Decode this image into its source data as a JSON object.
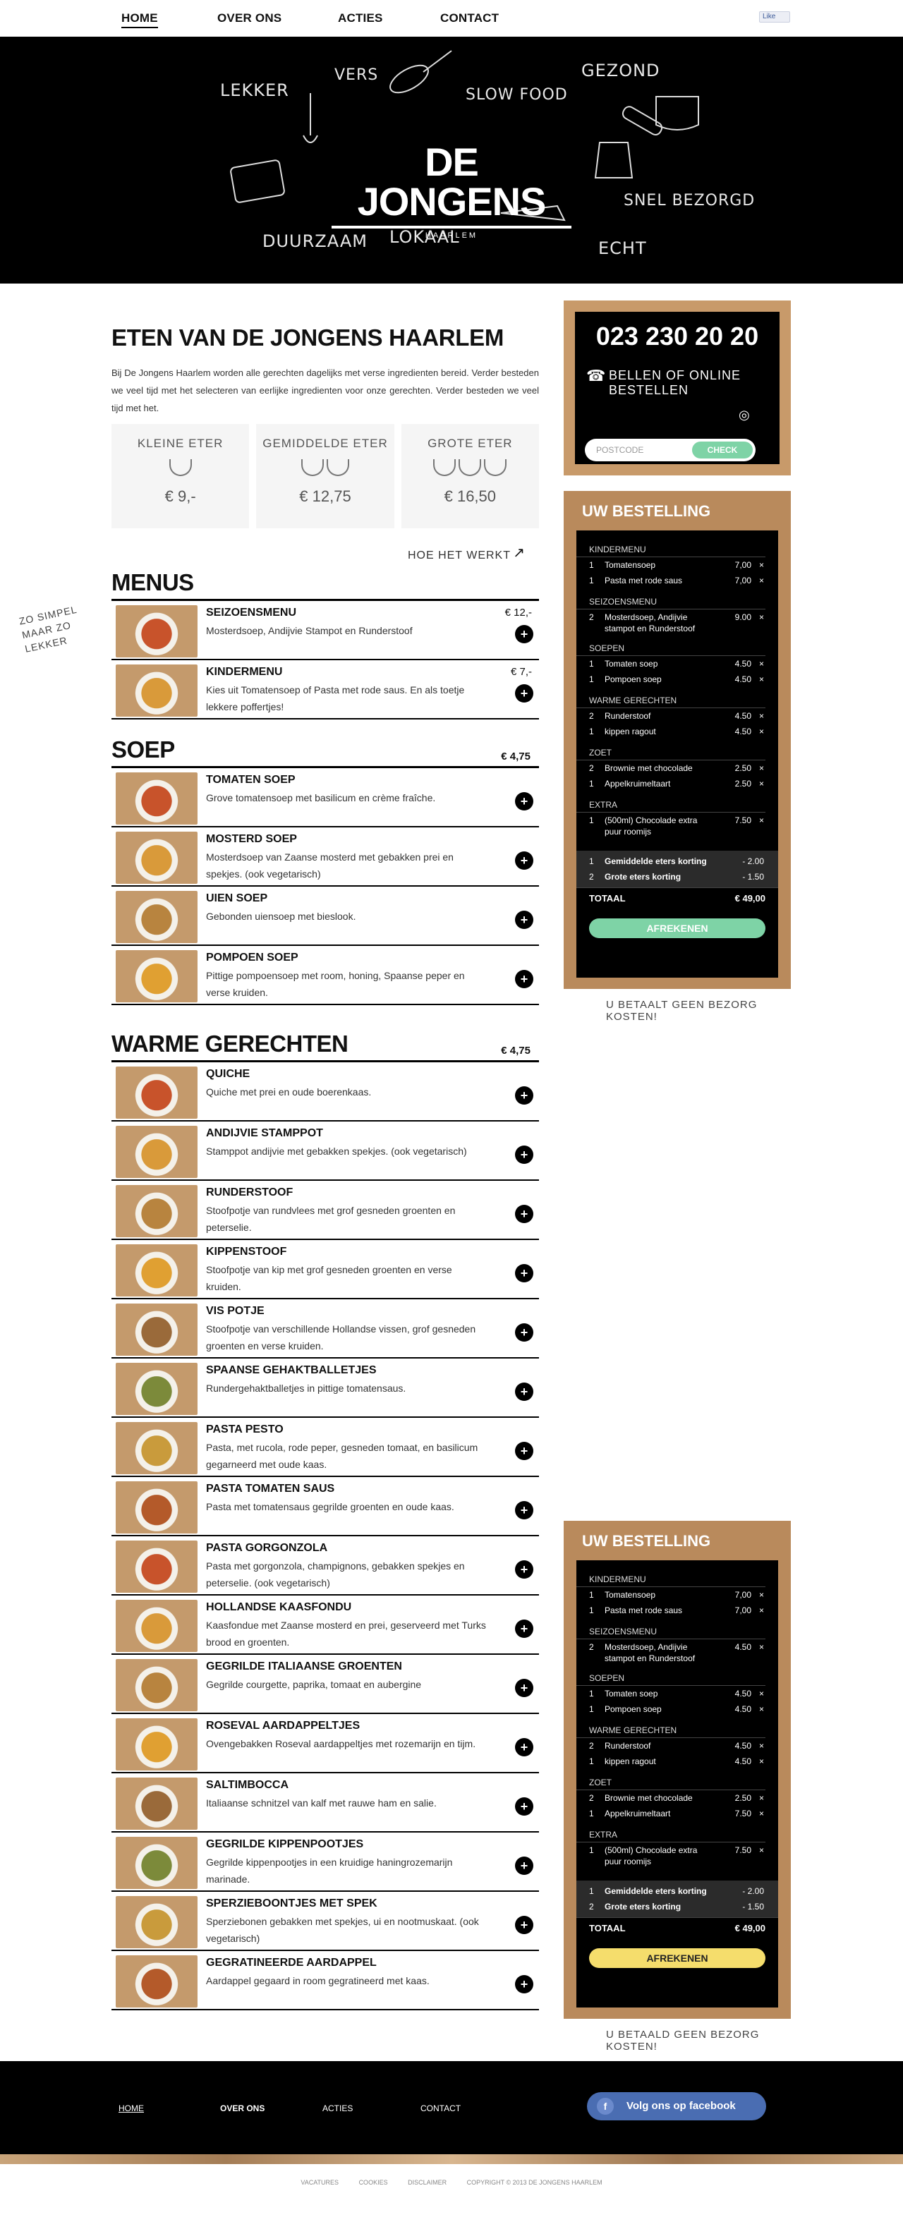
{
  "nav": {
    "home": "HOME",
    "over": "OVER ONS",
    "acties": "ACTIES",
    "contact": "CONTACT",
    "like": "Like"
  },
  "hero": {
    "words": [
      "LEKKER",
      "VERS",
      "SLOW FOOD",
      "GEZOND",
      "SNEL BEZORGD",
      "ECHT",
      "LOKAAL",
      "DUURZAAM"
    ],
    "logo_name": "DE JONGENS",
    "logo_city": "HAARLEM"
  },
  "intro": {
    "title": "ETEN VAN DE JONGENS HAARLEM",
    "text": "Bij De Jongens Haarlem worden alle gerechten dagelijks met verse ingredienten bereid. Verder besteden we veel tijd met het selecteren van eerlijke ingredienten voor onze gerechten. Verder besteden we veel tijd met het."
  },
  "sizes": [
    {
      "label": "KLEINE ETER",
      "price": "€ 9,-",
      "cups": 1
    },
    {
      "label": "GEMIDDELDE ETER",
      "price": "€ 12,75",
      "cups": 2
    },
    {
      "label": "GROTE ETER",
      "price": "€ 16,50",
      "cups": 3
    }
  ],
  "hoe": "HOE HET WERKT",
  "simpel": "ZO SIMPEL MAAR ZO LEKKER",
  "menus": {
    "title": "MENUS",
    "items": [
      {
        "name": "SEIZOENSMENU",
        "desc": "Mosterdsoep, Andijvie Stampot en Runderstoof",
        "price": "€ 12,-"
      },
      {
        "name": "KINDERMENU",
        "desc": "Kies uit Tomatensoep of Pasta met rode saus. En als toetje lekkere poffertjes!",
        "price": "€ 7,-"
      }
    ]
  },
  "soep": {
    "title": "SOEP",
    "price": "€ 4,75",
    "items": [
      {
        "name": "TOMATEN SOEP",
        "desc": "Grove tomatensoep met basilicum en crème fraîche."
      },
      {
        "name": "MOSTERD SOEP",
        "desc": "Mosterdsoep van Zaanse mosterd met gebakken prei en spekjes. (ook vegetarisch)"
      },
      {
        "name": "UIEN SOEP",
        "desc": "Gebonden uiensoep met bieslook."
      },
      {
        "name": "POMPOEN SOEP",
        "desc": "Pittige pompoensoep met room, honing, Spaanse peper en verse kruiden."
      }
    ]
  },
  "warm": {
    "title": "WARME GERECHTEN",
    "price": "€ 4,75",
    "items": [
      {
        "name": "QUICHE",
        "desc": "Quiche met prei en oude boerenkaas."
      },
      {
        "name": "ANDIJVIE STAMPPOT",
        "desc": "Stamppot andijvie met gebakken spekjes. (ook vegetarisch)"
      },
      {
        "name": "RUNDERSTOOF",
        "desc": "Stoofpotje van rundvlees met grof gesneden groenten en peterselie."
      },
      {
        "name": "KIPPENSTOOF",
        "desc": "Stoofpotje van kip met grof gesneden groenten en verse kruiden."
      },
      {
        "name": "VIS POTJE",
        "desc": "Stoofpotje van verschillende Hollandse vissen, grof gesneden groenten en verse kruiden."
      },
      {
        "name": "SPAANSE GEHAKTBALLETJES",
        "desc": "Rundergehaktballetjes in pittige tomatensaus."
      },
      {
        "name": "PASTA PESTO",
        "desc": "Pasta, met rucola, rode peper, gesneden tomaat, en basilicum gegarneerd met oude kaas."
      },
      {
        "name": "PASTA TOMATEN SAUS",
        "desc": "Pasta met tomatensaus gegrilde groenten en oude kaas."
      },
      {
        "name": "PASTA GORGONZOLA",
        "desc": "Pasta met gorgonzola, champignons, gebakken spekjes en peterselie. (ook vegetarisch)"
      },
      {
        "name": "HOLLANDSE KAASFONDU",
        "desc": "Kaasfondue met Zaanse mosterd en prei, geserveerd met Turks brood en groenten."
      },
      {
        "name": "GEGRILDE ITALIAANSE GROENTEN",
        "desc": "Gegrilde courgette, paprika, tomaat en aubergine"
      },
      {
        "name": "ROSEVAL AARDAPPELTJES",
        "desc": "Ovengebakken Roseval aardappeltjes met rozemarijn en tijm."
      },
      {
        "name": "SALTIMBOCCA",
        "desc": "Italiaanse schnitzel van kalf met rauwe ham en salie."
      },
      {
        "name": "GEGRILDE KIPPENPOOTJES",
        "desc": "Gegrilde kippenpootjes in een kruidige haningrozemarijn marinade."
      },
      {
        "name": "SPERZIEBOONTJES MET SPEK",
        "desc": "Sperziebonen gebakken met spekjes, ui en nootmuskaat. (ook vegetarisch)"
      },
      {
        "name": "GEGRATINEERDE AARDAPPEL",
        "desc": "Aardappel gegaard in room gegratineerd met kaas."
      }
    ]
  },
  "phonebox": {
    "phone": "023 230 20 20",
    "label": "BELLEN OF ONLINE BESTELLEN",
    "placeholder": "POSTCODE",
    "check": "CHECK"
  },
  "order1": {
    "title": "UW BESTELLING",
    "groups": [
      {
        "cat": "KINDERMENU",
        "lines": [
          {
            "q": "1",
            "n": "Tomatensoep",
            "p": "7,00"
          },
          {
            "q": "1",
            "n": "Pasta met rode saus",
            "p": "7,00"
          }
        ]
      },
      {
        "cat": "SEIZOENSMENU",
        "lines": [
          {
            "q": "2",
            "n": "Mosterdsoep, Andijvie stampot en Runderstoof",
            "p": "9.00"
          }
        ]
      },
      {
        "cat": "SOEPEN",
        "lines": [
          {
            "q": "1",
            "n": "Tomaten soep",
            "p": "4.50"
          },
          {
            "q": "1",
            "n": "Pompoen soep",
            "p": "4.50"
          }
        ]
      },
      {
        "cat": "WARME GERECHTEN",
        "lines": [
          {
            "q": "2",
            "n": "Runderstoof",
            "p": "4.50"
          },
          {
            "q": "1",
            "n": "kippen ragout",
            "p": "4.50"
          }
        ]
      },
      {
        "cat": "ZOET",
        "lines": [
          {
            "q": "2",
            "n": "Brownie met chocolade",
            "p": "2.50"
          },
          {
            "q": "1",
            "n": "Appelkruimeltaart",
            "p": "2.50"
          }
        ]
      },
      {
        "cat": "EXTRA",
        "lines": [
          {
            "q": "1",
            "n": "(500ml) Chocolade extra puur roomijs",
            "p": "7.50"
          }
        ]
      }
    ],
    "disc": [
      {
        "q": "1",
        "n": "Gemiddelde eters korting",
        "p": "- 2.00"
      },
      {
        "q": "2",
        "n": "Grote eters korting",
        "p": "- 1.50"
      }
    ],
    "total_label": "TOTAAL",
    "total": "€ 49,00",
    "button": "AFREKENEN",
    "btn_color": "#7ed3a6"
  },
  "order2": {
    "title": "UW BESTELLING",
    "groups": [
      {
        "cat": "KINDERMENU",
        "lines": [
          {
            "q": "1",
            "n": "Tomatensoep",
            "p": "7,00"
          },
          {
            "q": "1",
            "n": "Pasta met rode saus",
            "p": "7,00"
          }
        ]
      },
      {
        "cat": "SEIZOENSMENU",
        "lines": [
          {
            "q": "2",
            "n": "Mosterdsoep, Andijvie stampot en Runderstoof",
            "p": "4.50"
          }
        ]
      },
      {
        "cat": "SOEPEN",
        "lines": [
          {
            "q": "1",
            "n": "Tomaten soep",
            "p": "4.50"
          },
          {
            "q": "1",
            "n": "Pompoen soep",
            "p": "4.50"
          }
        ]
      },
      {
        "cat": "WARME GERECHTEN",
        "lines": [
          {
            "q": "2",
            "n": "Runderstoof",
            "p": "4.50"
          },
          {
            "q": "1",
            "n": "kippen ragout",
            "p": "4.50"
          }
        ]
      },
      {
        "cat": "ZOET",
        "lines": [
          {
            "q": "2",
            "n": "Brownie met chocolade",
            "p": "2.50"
          },
          {
            "q": "1",
            "n": "Appelkruimeltaart",
            "p": "7.50"
          }
        ]
      },
      {
        "cat": "EXTRA",
        "lines": [
          {
            "q": "1",
            "n": "(500ml) Chocolade extra puur roomijs",
            "p": "7.50"
          }
        ]
      }
    ],
    "disc": [
      {
        "q": "1",
        "n": "Gemiddelde eters korting",
        "p": "- 2.00"
      },
      {
        "q": "2",
        "n": "Grote eters korting",
        "p": "- 1.50"
      }
    ],
    "total_label": "TOTAAL",
    "total": "€ 49,00",
    "button": "AFREKENEN",
    "btn_color": "#f5dd6c"
  },
  "note": "U BETAALT GEEN BEZORG KOSTEN!",
  "note2": "U BETAALD GEEN BEZORG KOSTEN!",
  "footer": {
    "home": "HOME",
    "over": "OVER ONS",
    "acties": "ACTIES",
    "contact": "CONTACT",
    "facebook": "Volg ons op facebook"
  },
  "bottom": [
    "VACATURES",
    "COOKIES",
    "DISCLAIMER",
    "COPYRIGHT © 2013 DE JONGENS HAARLEM"
  ],
  "colors": {
    "check": "#7ed3a6",
    "afrekenen_green": "#7ed3a6",
    "afrekenen_yellow": "#f5dd6c",
    "facebook": "#4a6db2"
  }
}
